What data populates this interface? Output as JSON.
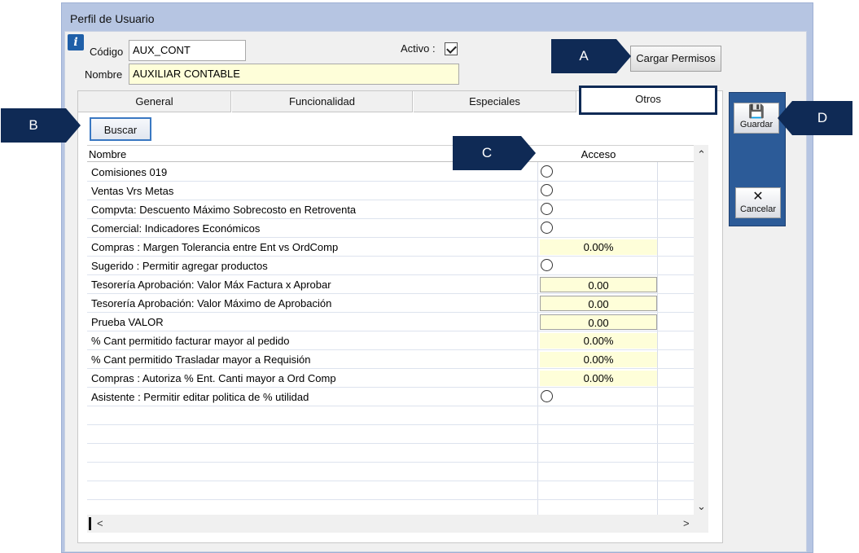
{
  "window": {
    "title": "Perfil de Usuario"
  },
  "form": {
    "codigo_label": "Código",
    "codigo_value": "AUX_CONT",
    "nombre_label": "Nombre",
    "nombre_value": "AUXILIAR CONTABLE",
    "activo_label": "Activo :",
    "activo_checked": true
  },
  "buttons": {
    "cargar_permisos": "Cargar Permisos",
    "buscar": "Buscar"
  },
  "callouts": {
    "a": "A",
    "b": "B",
    "c": "C",
    "d": "D"
  },
  "tabs": [
    {
      "label": "General",
      "active": false
    },
    {
      "label": "Funcionalidad",
      "active": false
    },
    {
      "label": "Especiales",
      "active": false
    },
    {
      "label": "Otros",
      "active": true
    }
  ],
  "grid": {
    "columns": [
      "Nombre",
      "Acceso"
    ],
    "rows": [
      {
        "name": "Comisiones 019",
        "type": "radio"
      },
      {
        "name": "Ventas Vrs Metas",
        "type": "radio"
      },
      {
        "name": "Compvta: Descuento Máximo Sobrecosto en Retroventa",
        "type": "radio"
      },
      {
        "name": "Comercial: Indicadores Económicos",
        "type": "radio"
      },
      {
        "name": "Compras : Margen Tolerancia entre Ent vs OrdComp",
        "type": "value",
        "value": "0.00%"
      },
      {
        "name": "Sugerido : Permitir agregar productos",
        "type": "radio"
      },
      {
        "name": "Tesorería Aprobación: Valor Máx Factura x Aprobar",
        "type": "boxed",
        "value": "0.00"
      },
      {
        "name": "Tesorería Aprobación: Valor Máximo de Aprobación",
        "type": "boxed",
        "value": "0.00"
      },
      {
        "name": "Prueba VALOR",
        "type": "boxed",
        "value": "0.00"
      },
      {
        "name": "% Cant permitido facturar mayor al pedido",
        "type": "value",
        "value": "0.00%"
      },
      {
        "name": "% Cant permitido Trasladar mayor a Requisión",
        "type": "value",
        "value": "0.00%"
      },
      {
        "name": "Compras : Autoriza % Ent. Canti mayor a Ord Comp",
        "type": "value",
        "value": "0.00%"
      },
      {
        "name": "Asistente : Permitir editar politica de % utilidad",
        "type": "radio"
      }
    ]
  },
  "sidebar": {
    "save_label": "Guardar",
    "cancel_label": "Cancelar"
  },
  "icons": {
    "info": "info-icon",
    "save": "floppy-disk-icon",
    "cancel": "x-cross-icon"
  },
  "colors": {
    "accent": "#0f2a55",
    "sidebar": "#2c5b98",
    "window": "#b6c5e2",
    "input_yellow": "#fefed9"
  }
}
